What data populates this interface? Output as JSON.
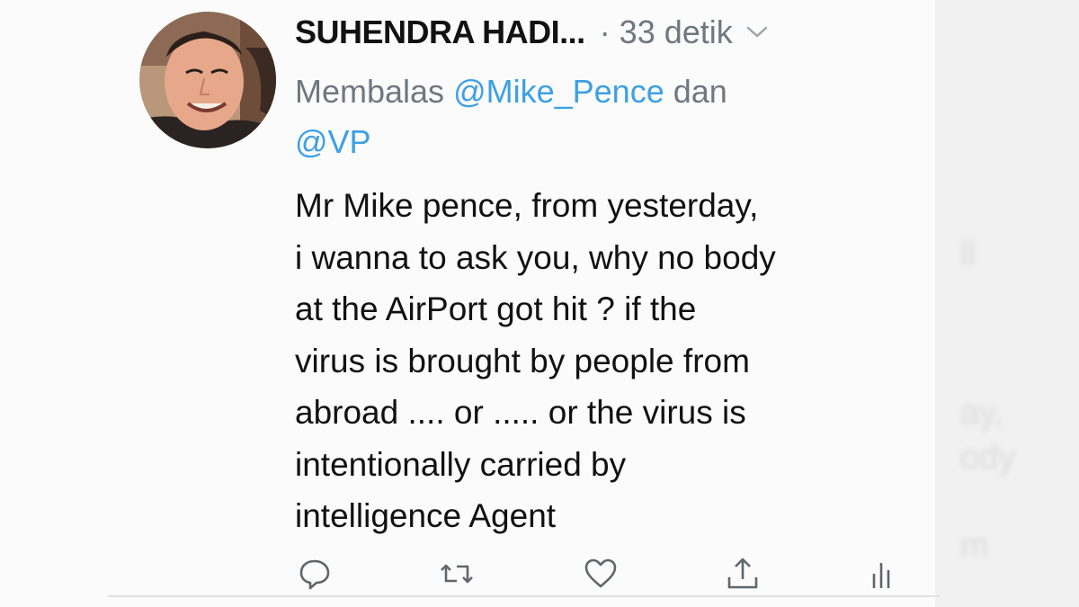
{
  "ghost_text": [
    "ll",
    "ay,",
    "ody",
    "m"
  ],
  "tweet": {
    "author": {
      "display_name": "SUHENDRA HADI...",
      "avatar_icon": "user-avatar-photo"
    },
    "time": "· 33 detik",
    "menu_icon": "chevron-down-icon",
    "reply_prefix": "Membalas",
    "reply_mention_1": "@Mike_Pence",
    "reply_conj": "dan",
    "reply_mention_2": "@VP",
    "text": "Mr Mike pence, from yesterday,\ni wanna to ask you, why no body\nat the AirPort got hit ? if the\nvirus is brought by people from\nabroad .... or ..... or the virus is\nintentionally carried by\nintelligence Agent",
    "actions": [
      "reply-icon",
      "retweet-icon",
      "like-icon",
      "share-icon",
      "analytics-icon"
    ]
  },
  "colors": {
    "text": "#111111",
    "meta": "#6f7780",
    "mention": "#3ea0e4",
    "background": "#fbfbfb"
  }
}
